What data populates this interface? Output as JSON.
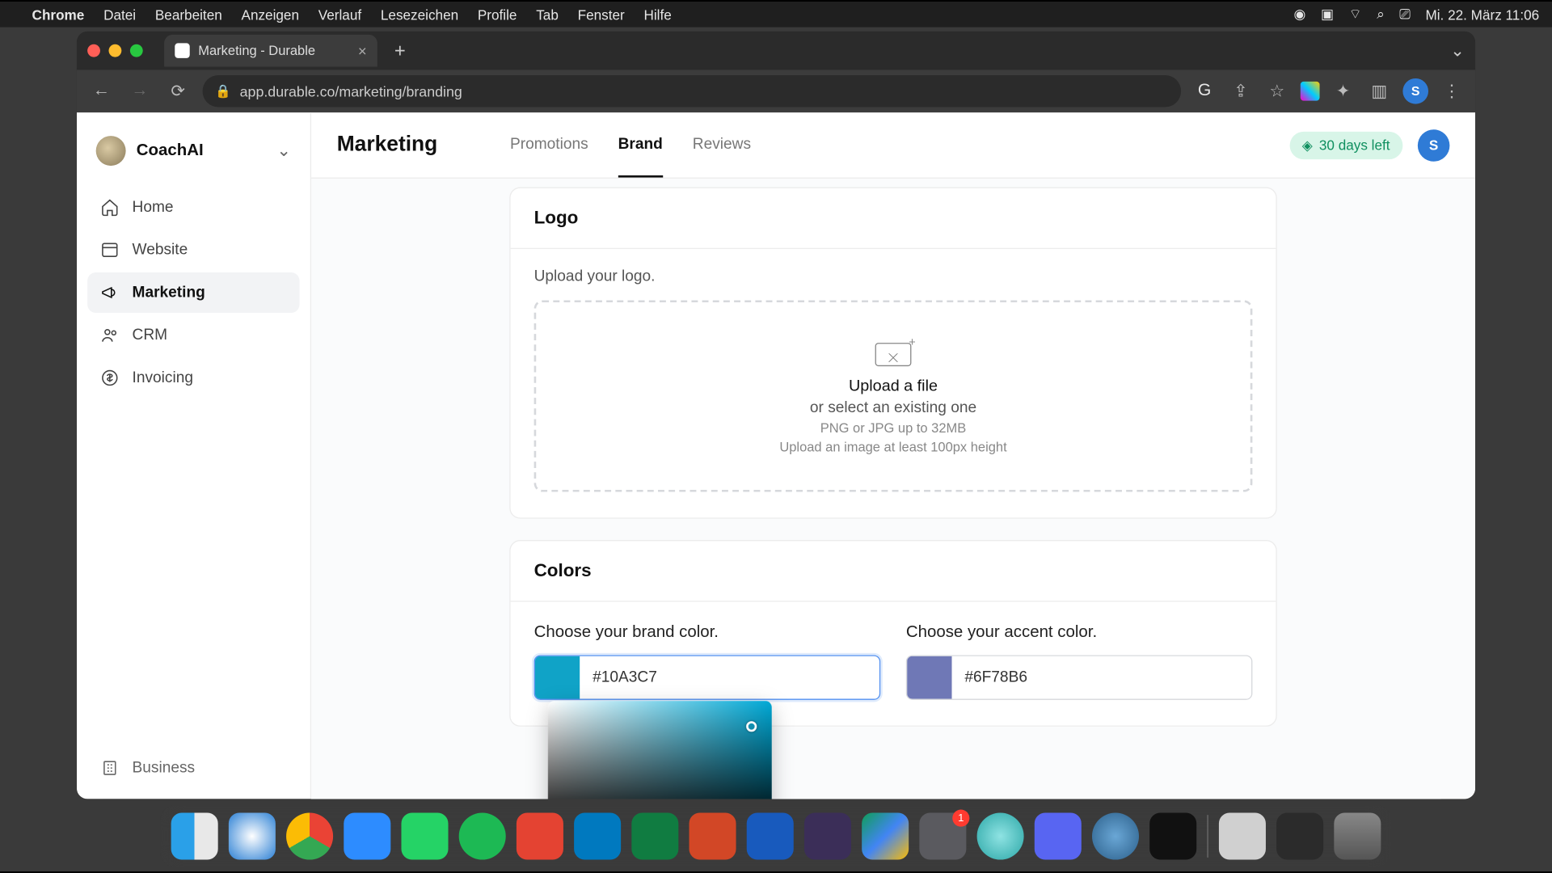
{
  "mac_menu": {
    "app": "Chrome",
    "items": [
      "Datei",
      "Bearbeiten",
      "Anzeigen",
      "Verlauf",
      "Lesezeichen",
      "Profile",
      "Tab",
      "Fenster",
      "Hilfe"
    ],
    "clock": "Mi. 22. März  11:06"
  },
  "browser": {
    "tab_title": "Marketing - Durable",
    "url": "app.durable.co/marketing/branding",
    "profile_initial": "S"
  },
  "sidebar": {
    "workspace": "CoachAI",
    "items": [
      {
        "key": "home",
        "label": "Home"
      },
      {
        "key": "website",
        "label": "Website"
      },
      {
        "key": "marketing",
        "label": "Marketing"
      },
      {
        "key": "crm",
        "label": "CRM"
      },
      {
        "key": "invoicing",
        "label": "Invoicing"
      }
    ],
    "active": "marketing",
    "bottom": {
      "key": "business",
      "label": "Business"
    }
  },
  "topbar": {
    "title": "Marketing",
    "tabs": [
      {
        "key": "promotions",
        "label": "Promotions"
      },
      {
        "key": "brand",
        "label": "Brand"
      },
      {
        "key": "reviews",
        "label": "Reviews"
      }
    ],
    "active": "brand",
    "trial_label": "30 days left",
    "user_initial": "S"
  },
  "logo_card": {
    "heading": "Logo",
    "subtitle": "Upload your logo.",
    "upload_link": "Upload a file",
    "upload_or": "or select an existing one",
    "hint1": "PNG or JPG up to 32MB",
    "hint2": "Upload an image at least 100px height"
  },
  "colors_card": {
    "heading": "Colors",
    "brand_label": "Choose your brand color.",
    "brand_value": "#10A3C7",
    "brand_swatch": "#10A3C7",
    "accent_label": "Choose your accent color.",
    "accent_value": "#6F78B6",
    "accent_swatch": "#6F78B6"
  },
  "dock_badge_count": "1"
}
